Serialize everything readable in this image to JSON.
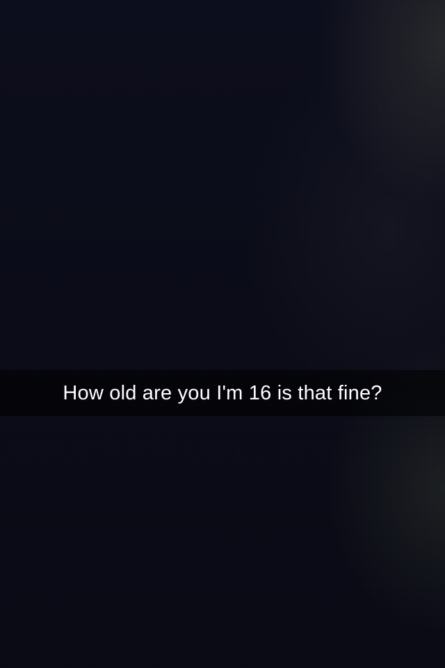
{
  "snap": {
    "caption": "How old are you I'm 16 is that fine?"
  }
}
